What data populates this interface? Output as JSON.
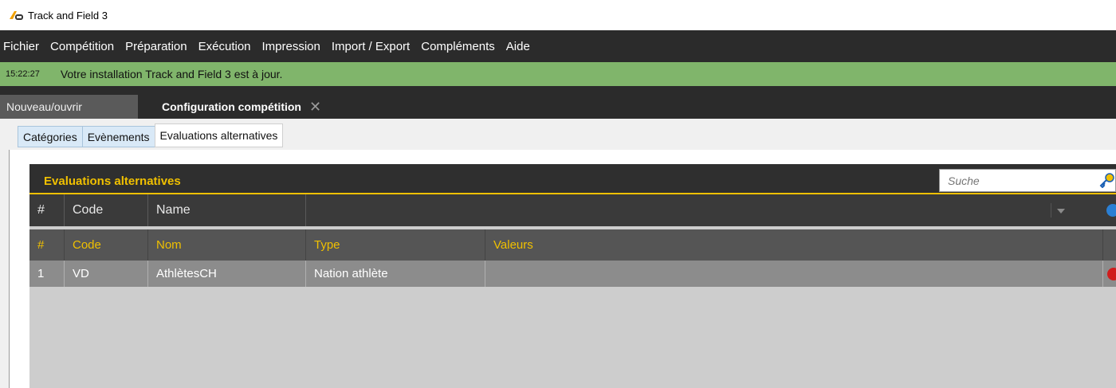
{
  "window": {
    "title": "Track and Field 3"
  },
  "menu": [
    "Fichier",
    "Compétition",
    "Préparation",
    "Exécution",
    "Impression",
    "Import / Export",
    "Compléments",
    "Aide"
  ],
  "status": {
    "time": "15:22:27",
    "message": "Votre installation Track and Field 3 est à jour."
  },
  "doc_tabs": {
    "inactive": "Nouveau/ouvrir",
    "active": "Configuration compétition",
    "close_glyph": "✕"
  },
  "sub_tabs": [
    "Catégories",
    "Evènements",
    "Evaluations alternatives"
  ],
  "grid": {
    "title": "Evaluations alternatives",
    "search_placeholder": "Suche",
    "filter_row": {
      "hash": "#",
      "code": "Code",
      "name": "Name"
    },
    "columns": {
      "hash": "#",
      "code": "Code",
      "nom": "Nom",
      "type": "Type",
      "valeurs": "Valeurs"
    },
    "rows": [
      {
        "num": "1",
        "code": "VD",
        "nom": "AthlètesCH",
        "type": "Nation athlète",
        "valeurs": ""
      }
    ]
  },
  "colors": {
    "menubar": "#2b2b2b",
    "status_green": "#80b56b",
    "accent_yellow": "#f0c000"
  }
}
